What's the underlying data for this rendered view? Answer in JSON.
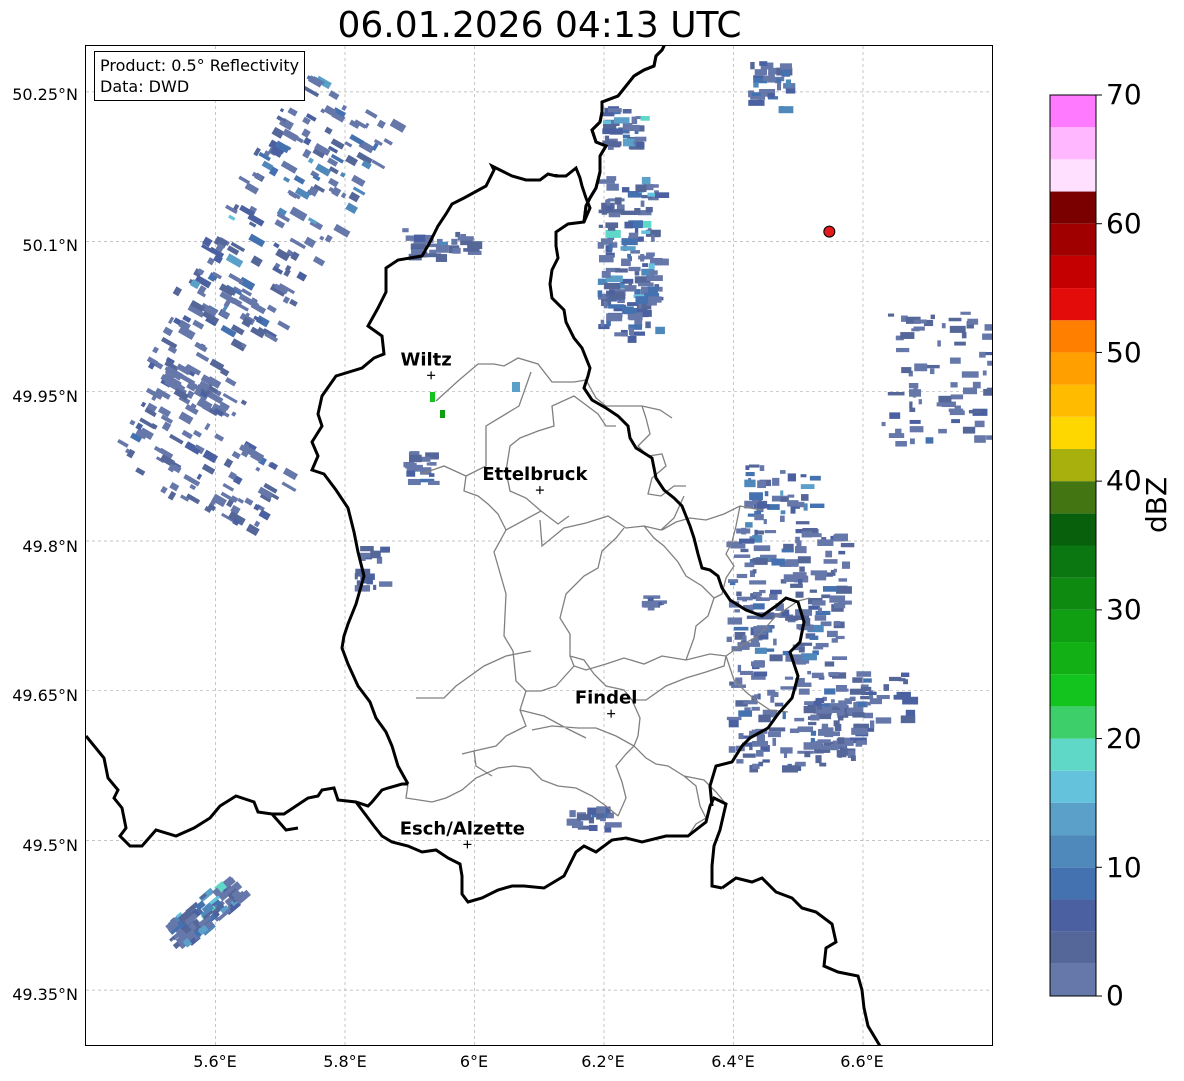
{
  "title": "06.01.2026 04:13 UTC",
  "info": {
    "product": "Product: 0.5° Reflectivity",
    "data": "Data: DWD"
  },
  "lat_ticks": [
    "49.35°N",
    "49.5°N",
    "49.65°N",
    "49.8°N",
    "49.95°N",
    "50.1°N",
    "50.25°N"
  ],
  "lon_ticks": [
    "5.6°E",
    "5.8°E",
    "6°E",
    "6.2°E",
    "6.4°E",
    "6.6°E"
  ],
  "cities": [
    {
      "name": "Wiltz",
      "lat": 49.966,
      "lon": 5.933
    },
    {
      "name": "Ettelbruck",
      "lat": 49.851,
      "lon": 6.101
    },
    {
      "name": "Findel",
      "lat": 49.627,
      "lon": 6.211
    },
    {
      "name": "Esch/Alzette",
      "lat": 49.496,
      "lon": 5.989
    }
  ],
  "radar_site": {
    "lat": 50.11,
    "lon": 6.548,
    "color": "#e31a1c"
  },
  "colorbar": {
    "label": "dBZ",
    "min": 0,
    "max": 70,
    "ticks": [
      "0",
      "10",
      "20",
      "30",
      "40",
      "50",
      "60",
      "70"
    ],
    "colors": [
      "#6677aa",
      "#556699",
      "#4a60a0",
      "#4472b0",
      "#4f88bb",
      "#5ba0c8",
      "#65c2dd",
      "#5fd8c8",
      "#3dd06a",
      "#13c31e",
      "#12b015",
      "#109e12",
      "#0f8a10",
      "#0b7710",
      "#085f0c",
      "#437612",
      "#a8b00d",
      "#ffd700",
      "#ffbb00",
      "#ff9f00",
      "#ff8000",
      "#e40b0b",
      "#c40000",
      "#a00000",
      "#7a0000",
      "#ffe0ff",
      "#ffb7ff",
      "#ff7aff",
      "#e84ae8"
    ]
  },
  "gridline_color": "#b0b0b0"
}
